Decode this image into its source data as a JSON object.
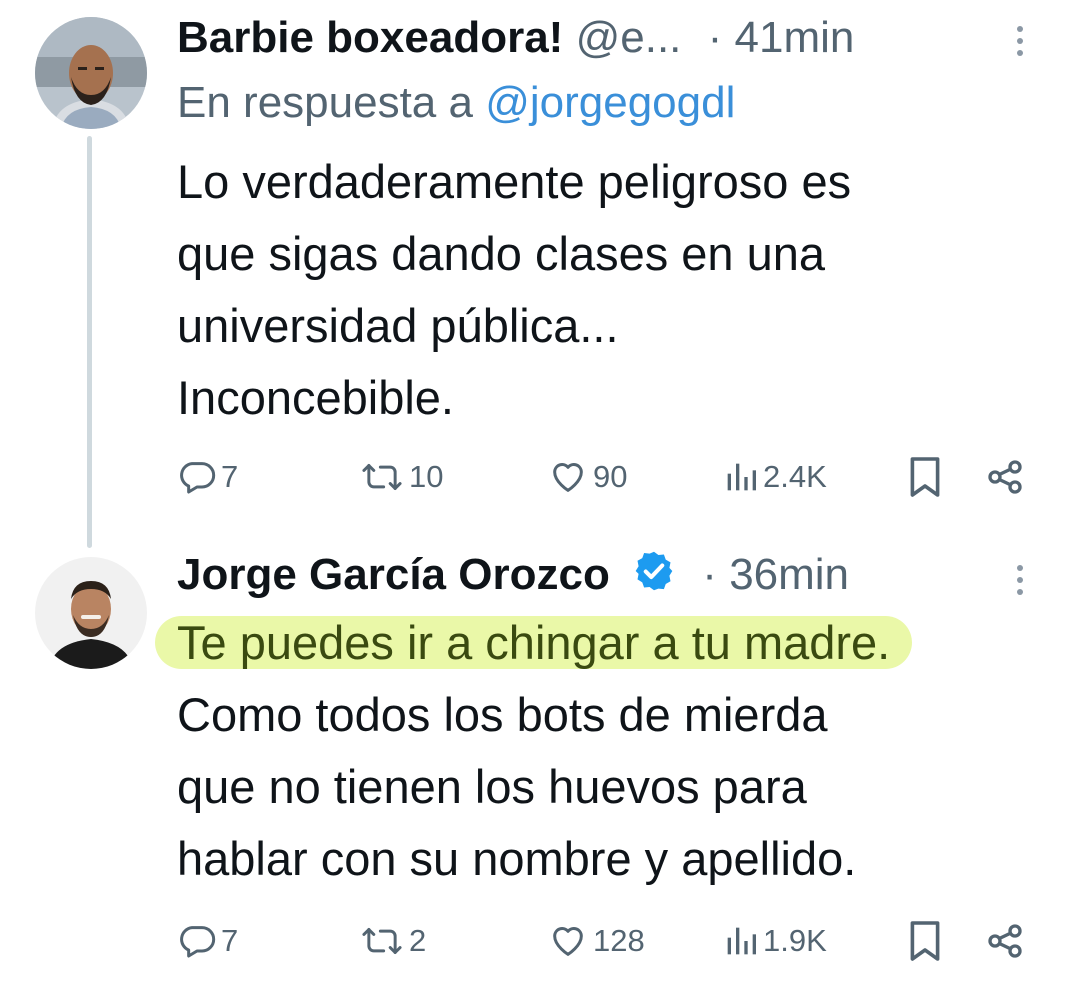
{
  "tweets": [
    {
      "author_name": "Barbie boxeadora!",
      "handle": "@e...",
      "separator": "·",
      "time": "41min",
      "reply_prefix": "En respuesta a",
      "reply_mention": "@jorgegogdl",
      "text_lines": [
        "Lo verdaderamente peligroso es",
        "que sigas dando clases en una",
        "universidad pública...",
        "Inconcebible."
      ],
      "metrics": {
        "replies": "7",
        "reposts": "10",
        "likes": "90",
        "views": "2.4K"
      }
    },
    {
      "author_name": "Jorge García Orozco",
      "verified": true,
      "separator": "·",
      "time": "36min",
      "highlighted_line": "Te puedes ir a chingar a tu madre.",
      "text_lines": [
        "Como todos los bots de mierda",
        "que no tienen los huevos para",
        "hablar con su nombre y apellido."
      ],
      "metrics": {
        "replies": "7",
        "reposts": "2",
        "likes": "128",
        "views": "1.9K"
      }
    }
  ],
  "colors": {
    "secondary_text": "#536471",
    "mention": "#3a8fd9",
    "verified_badge": "#1d9bf0",
    "highlight": "#eaf8a8",
    "thread_line": "#cfd9de"
  },
  "icons": [
    "reply-icon",
    "repost-icon",
    "like-icon",
    "views-icon",
    "bookmark-icon",
    "share-icon",
    "more-icon",
    "verified-badge-icon"
  ]
}
